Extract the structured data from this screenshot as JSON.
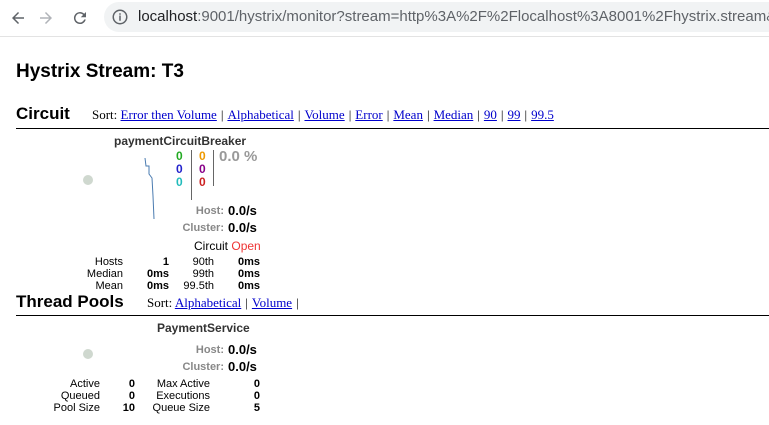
{
  "browser": {
    "url_host": "localhost",
    "url_rest": ":9001/hystrix/monitor?stream=http%3A%2F%2Flocalhost%3A8001%2Fhystrix.stream&"
  },
  "page": {
    "title": "Hystrix Stream: T3"
  },
  "circuit_section": {
    "title": "Circuit",
    "sort_label": "Sort:",
    "sort_options": [
      "Error then Volume",
      "Alphabetical",
      "Volume",
      "Error",
      "Mean",
      "Median",
      "90",
      "99",
      "99.5"
    ]
  },
  "circuit": {
    "name": "paymentCircuitBreaker",
    "counts_col1": [
      "0",
      "0",
      "0"
    ],
    "counts_col2": [
      "0",
      "0",
      "0"
    ],
    "count_colors_col1": [
      "#2a2",
      "#22c",
      "#2bb"
    ],
    "count_colors_col2": [
      "#e90",
      "#808",
      "#c22"
    ],
    "error_percent": "0.0 %",
    "host_label": "Host:",
    "host_value": "0.0/s",
    "cluster_label": "Cluster:",
    "cluster_value": "0.0/s",
    "status_label": "Circuit",
    "status_value": "Open",
    "status_color": "#e33",
    "stats": {
      "hosts_label": "Hosts",
      "hosts_value": "1",
      "median_label": "Median",
      "median_value": "0ms",
      "mean_label": "Mean",
      "mean_value": "0ms",
      "p90_label": "90th",
      "p90_value": "0ms",
      "p99_label": "99th",
      "p99_value": "0ms",
      "p995_label": "99.5th",
      "p995_value": "0ms"
    }
  },
  "thread_section": {
    "title": "Thread Pools",
    "sort_label": "Sort:",
    "sort_options": [
      "Alphabetical",
      "Volume"
    ]
  },
  "thread_pool": {
    "name": "PaymentService",
    "host_label": "Host:",
    "host_value": "0.0/s",
    "cluster_label": "Cluster:",
    "cluster_value": "0.0/s",
    "stats": {
      "active_label": "Active",
      "active_value": "0",
      "queued_label": "Queued",
      "queued_value": "0",
      "pool_size_label": "Pool Size",
      "pool_size_value": "10",
      "max_active_label": "Max Active",
      "max_active_value": "0",
      "executions_label": "Executions",
      "executions_value": "0",
      "queue_size_label": "Queue Size",
      "queue_size_value": "5"
    }
  }
}
